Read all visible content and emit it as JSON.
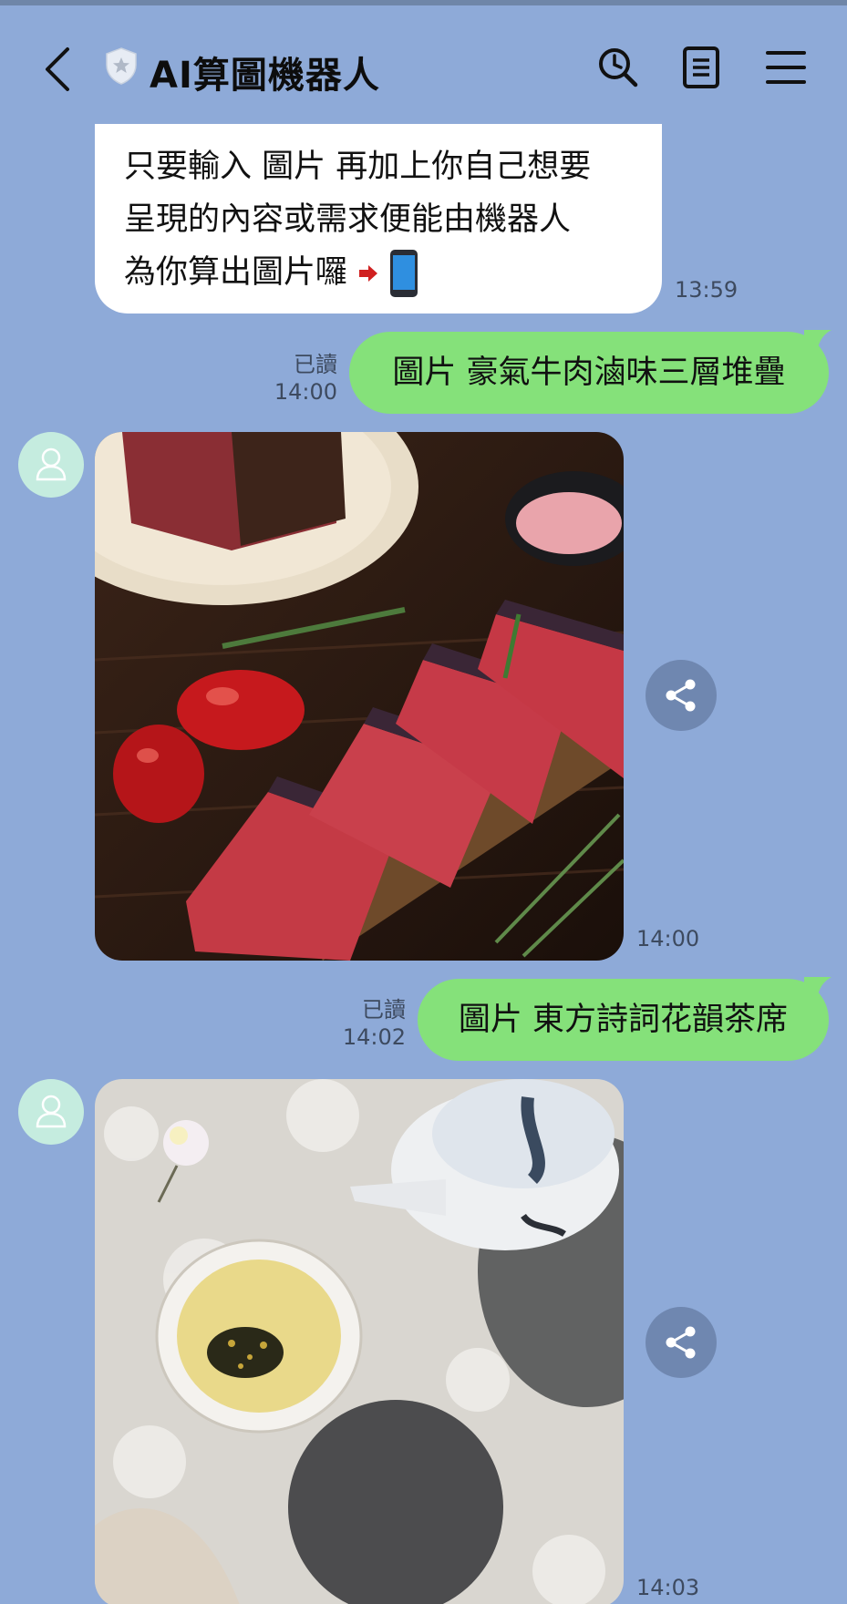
{
  "header": {
    "title": "AI算圖機器人",
    "icons": [
      "back-arrow-icon",
      "shield-icon",
      "search-icon",
      "notes-icon",
      "menu-icon"
    ]
  },
  "messages": {
    "bot_text": {
      "lines": [
        "只要輸入 圖片 再加上你自己想要",
        "呈現的內容或需求便能由機器人",
        "為你算出圖片囉"
      ],
      "time": "13:59"
    },
    "user_1": {
      "text": "圖片 豪氣牛肉滷味三層堆疊",
      "read": "已讀",
      "time": "14:00"
    },
    "image_1": {
      "time": "14:00"
    },
    "user_2": {
      "text": "圖片 東方詩詞花韻茶席",
      "read": "已讀",
      "time": "14:02"
    },
    "image_2": {
      "time": "14:03"
    }
  },
  "colors": {
    "background": "#8eaad8",
    "user_bubble": "#85e17a",
    "bot_bubble": "#ffffff",
    "avatar": "#c5ecdf"
  }
}
